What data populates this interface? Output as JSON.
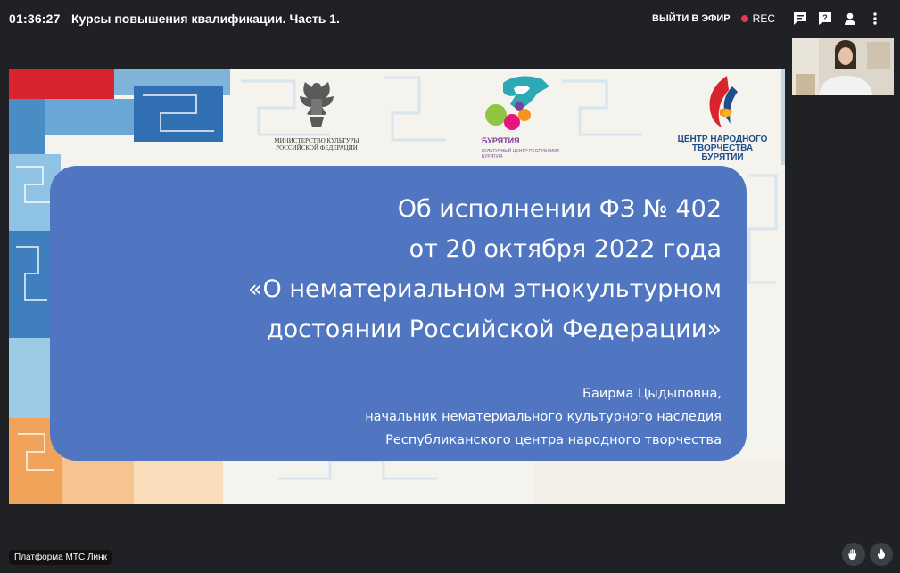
{
  "header": {
    "timer": "01:36:27",
    "title": "Курсы повышения квалификации. Часть 1.",
    "go_live_label": "ВЫЙТИ В ЭФИР",
    "rec_label": "REC",
    "icons": [
      "chat-icon",
      "question-icon",
      "participants-icon",
      "more-icon"
    ]
  },
  "slide": {
    "ministry_text": [
      "МИНИСТЕРСТВО КУЛЬТУРЫ",
      "РОССИЙСКОЙ ФЕДЕРАЦИИ"
    ],
    "buryatia_logo_text": "БУРЯТИЯ",
    "buryatia_sub": "КУЛЬТУРНЫЙ ЦЕНТР РЕСПУБЛИКИ БУРЯТИЯ",
    "center_text": [
      "ЦЕНТР НАРОДНОГО",
      "ТВОРЧЕСТВА",
      "БУРЯТИИ"
    ],
    "title_lines": [
      "Об исполнении ФЗ № 402",
      "от 20 октября 2022 года",
      "«О нематериальном этнокультурном",
      "достоянии Российской Федерации»"
    ],
    "author_lines": [
      "Баирма Цыдыповна,",
      "начальник нематериального культурного наследия",
      "Республиканского центра народного творчества"
    ]
  },
  "footer": {
    "platform_label": "Платформа МТС Линк"
  },
  "colors": {
    "background": "#202124",
    "slide_box": "#5076c2",
    "rec": "#e8384f"
  }
}
